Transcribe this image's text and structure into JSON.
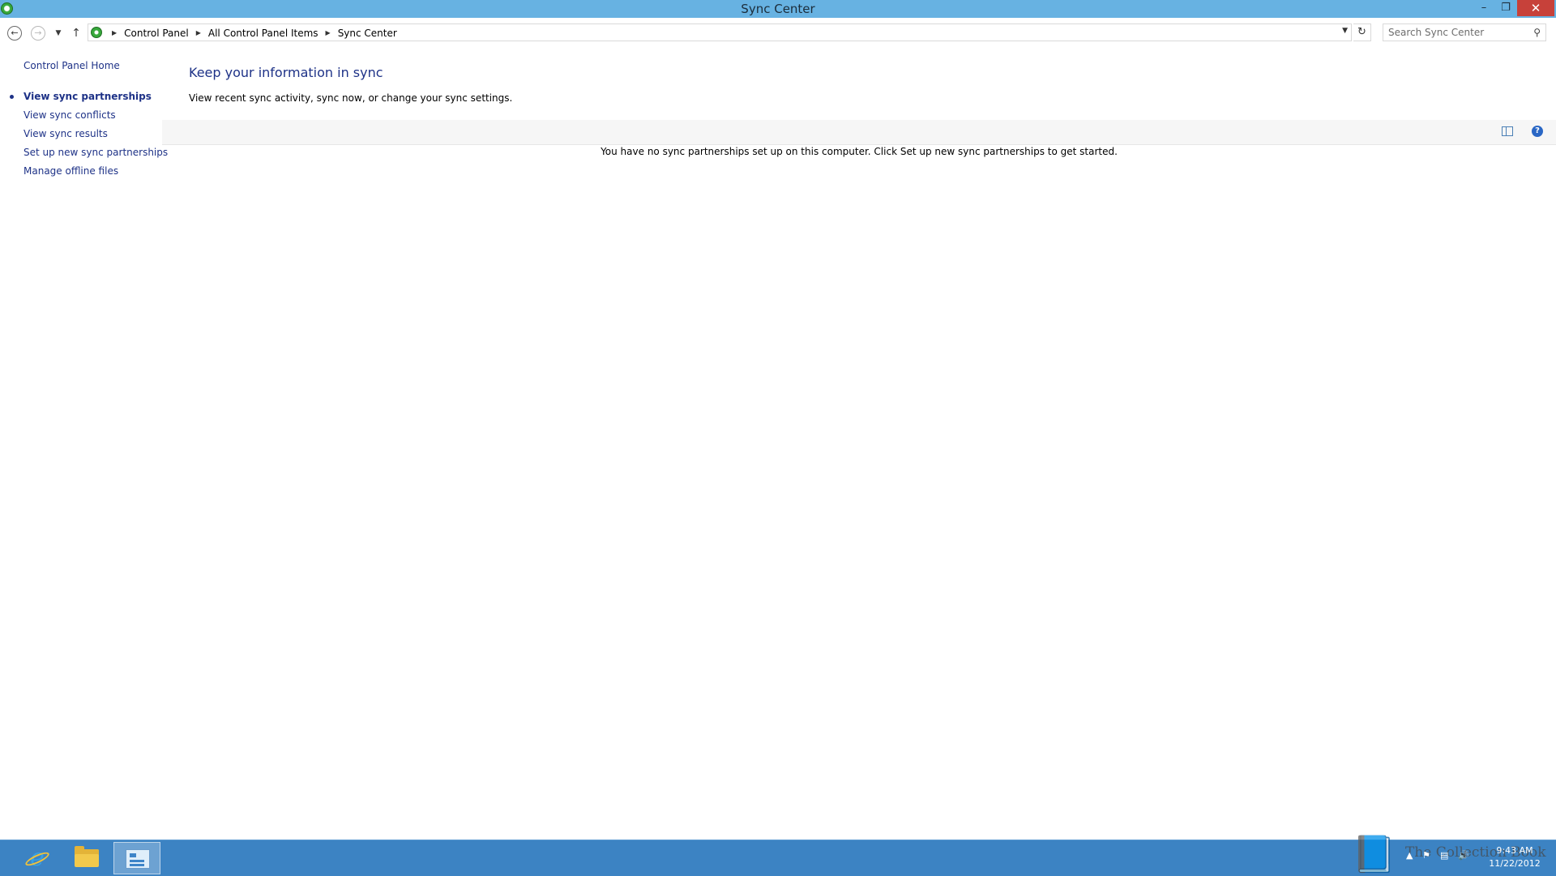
{
  "window": {
    "title": "Sync Center",
    "minimize_glyph": "–",
    "maximize_glyph": "❐",
    "close_glyph": "✕"
  },
  "navigation": {
    "breadcrumbs": [
      "Control Panel",
      "All Control Panel Items",
      "Sync Center"
    ],
    "search_placeholder": "Search Sync Center"
  },
  "sidebar": {
    "home": "Control Panel Home",
    "items": [
      {
        "label": "View sync partnerships",
        "active": true
      },
      {
        "label": "View sync conflicts",
        "active": false
      },
      {
        "label": "View sync results",
        "active": false
      },
      {
        "label": "Set up new sync partnerships",
        "active": false
      },
      {
        "label": "Manage offline files",
        "active": false
      }
    ]
  },
  "main": {
    "heading": "Keep your information in sync",
    "subtext": "View recent sync activity, sync now, or change your sync settings.",
    "empty_message": "You have no sync partnerships set up on this computer. Click Set up new sync partnerships to get started."
  },
  "taskbar": {
    "apps": [
      {
        "name": "internet-explorer",
        "icon": "ie-icon"
      },
      {
        "name": "file-explorer",
        "icon": "folder-icon"
      },
      {
        "name": "control-panel",
        "icon": "control-panel-icon",
        "active": true
      }
    ],
    "clock_time": "9:43 AM",
    "clock_date": "11/22/2012"
  },
  "watermark": {
    "text": "The Collection Book"
  },
  "colors": {
    "titlebar": "#67b2e2",
    "taskbar": "#3c83c3",
    "link": "#1e3287",
    "close": "#c7413a"
  }
}
